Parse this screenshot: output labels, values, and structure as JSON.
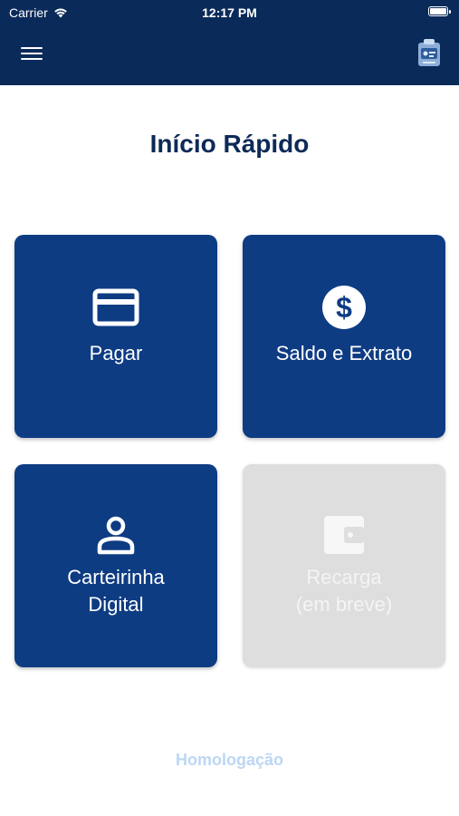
{
  "status_bar": {
    "carrier": "Carrier",
    "time": "12:17 PM"
  },
  "header": {
    "menu_icon": "hamburger-menu-icon",
    "app_icon": "app-logo-icon"
  },
  "main": {
    "title": "Início Rápido",
    "tiles": [
      {
        "label": "Pagar",
        "icon": "credit-card-icon",
        "enabled": true
      },
      {
        "label": "Saldo e Extrato",
        "icon": "dollar-circle-icon",
        "enabled": true
      },
      {
        "label_line1": "Carteirinha",
        "label_line2": "Digital",
        "icon": "person-icon",
        "enabled": true
      },
      {
        "label_line1": "Recarga",
        "label_line2": "(em breve)",
        "icon": "wallet-icon",
        "enabled": false
      }
    ]
  },
  "footer": {
    "environment": "Homologação"
  },
  "colors": {
    "header": "#0a2a5a",
    "tile": "#0e3c83",
    "tile_disabled": "#dedede",
    "title": "#0d2a57",
    "env_text": "#bcd6f3"
  }
}
